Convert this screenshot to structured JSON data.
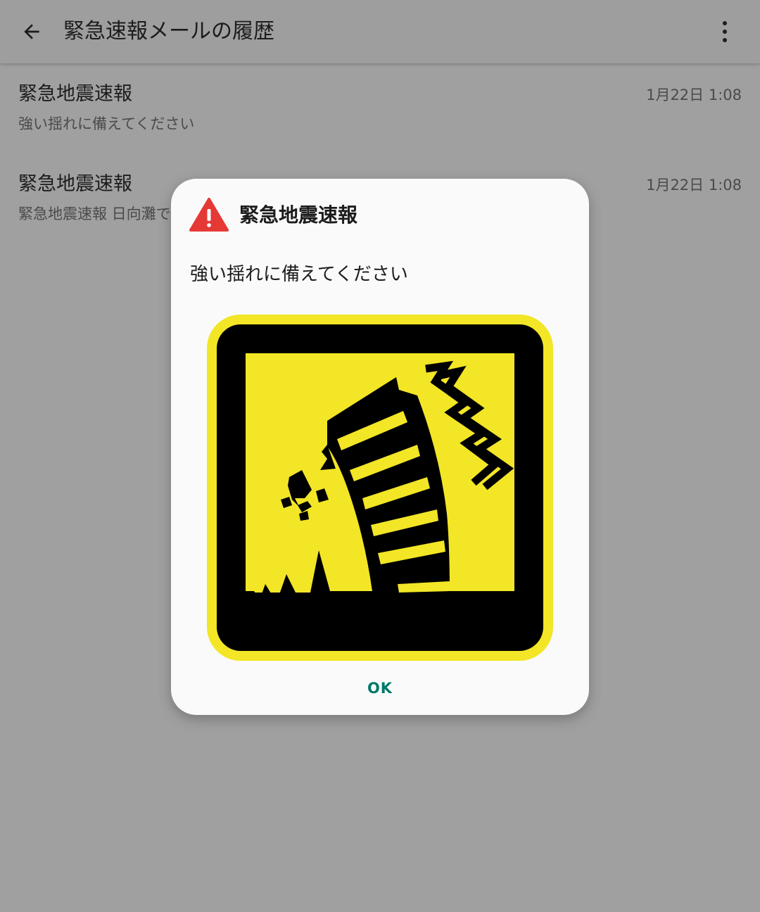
{
  "app_bar": {
    "title": "緊急速報メールの履歴",
    "back_icon": "arrow-back-icon",
    "overflow_icon": "more-vert-icon"
  },
  "messages": [
    {
      "title": "緊急地震速報",
      "body": "強い揺れに備えてください",
      "date": "1月22日 1:08"
    },
    {
      "title": "緊急地震速報",
      "body": "緊急地震速報 日向灘で",
      "date": "1月22日 1:08"
    }
  ],
  "dialog": {
    "title": "緊急地震速報",
    "message": "強い揺れに備えてください",
    "warning_icon": "warning-icon",
    "image": "earthquake-collapsing-building-icon",
    "ok_label": "OK"
  },
  "colors": {
    "scrim_background": "#a0a0a0",
    "warning_red": "#e53935",
    "pictogram_yellow": "#f2e626",
    "accent_teal": "#00796b"
  }
}
